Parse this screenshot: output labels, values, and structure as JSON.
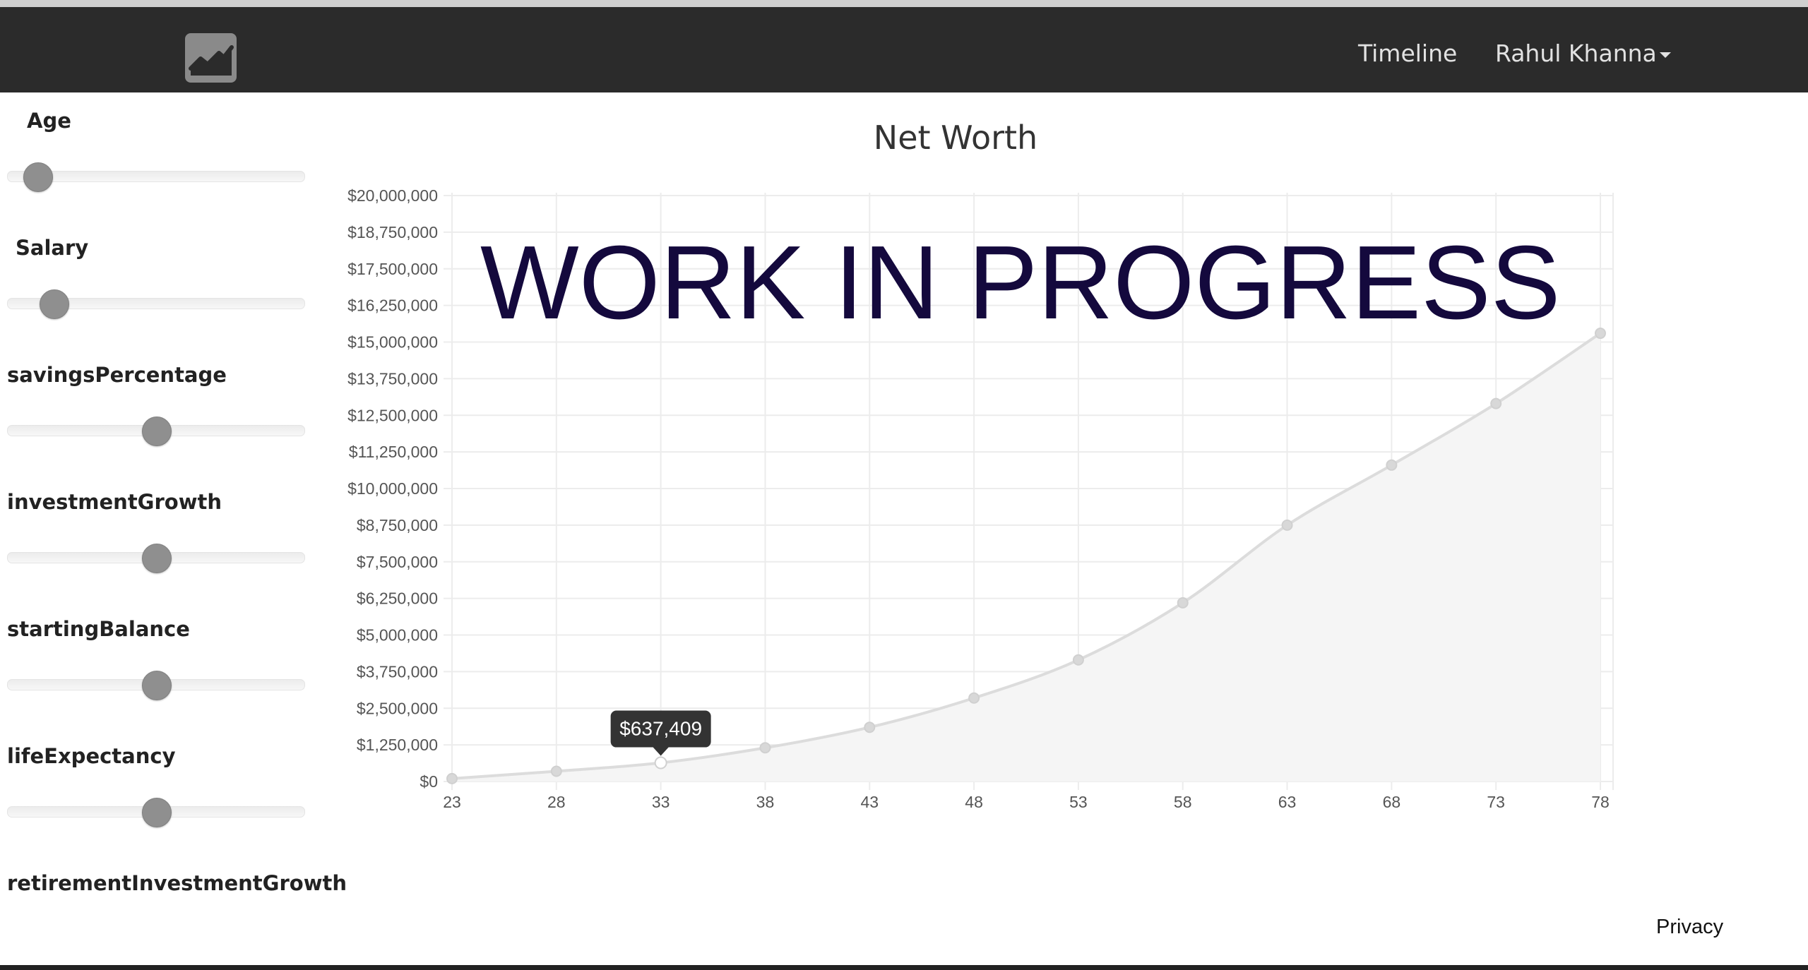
{
  "navbar": {
    "logo_icon": "line-chart-icon",
    "timeline_label": "Timeline",
    "user_label": "Rahul Khanna"
  },
  "sliders": [
    {
      "key": "age",
      "label": "Age",
      "value_fraction": 0.1
    },
    {
      "key": "salary",
      "label": "Salary",
      "value_fraction": 0.155
    },
    {
      "key": "savings",
      "label": "savingsPercentage",
      "value_fraction": 0.5
    },
    {
      "key": "growth",
      "label": "investmentGrowth",
      "value_fraction": 0.5
    },
    {
      "key": "balance",
      "label": "startingBalance",
      "value_fraction": 0.5
    },
    {
      "key": "life",
      "label": "lifeExpectancy",
      "value_fraction": 0.5
    },
    {
      "key": "retire",
      "label": "retirementInvestmentGrowth",
      "value_fraction": null
    }
  ],
  "chart_data": {
    "type": "area",
    "title": "Net Worth",
    "watermark": "WORK IN PROGRESS",
    "x": [
      23,
      28,
      33,
      38,
      43,
      48,
      53,
      58,
      63,
      68,
      73,
      78
    ],
    "values": [
      100000,
      350000,
      637409,
      1150000,
      1850000,
      2850000,
      4150000,
      6100000,
      8750000,
      10800000,
      12900000,
      15300000
    ],
    "ylim": [
      0,
      20000000
    ],
    "y_ticks": [
      "$0",
      "$1,250,000",
      "$2,500,000",
      "$3,750,000",
      "$5,000,000",
      "$6,250,000",
      "$7,500,000",
      "$8,750,000",
      "$10,000,000",
      "$11,250,000",
      "$12,500,000",
      "$13,750,000",
      "$15,000,000",
      "$16,250,000",
      "$17,500,000",
      "$18,750,000",
      "$20,000,000"
    ],
    "x_ticks": [
      "23",
      "28",
      "33",
      "38",
      "43",
      "48",
      "53",
      "58",
      "63",
      "68",
      "73",
      "78"
    ],
    "grid": true,
    "tooltip": {
      "index": 2,
      "label": "$637,409"
    },
    "colors": {
      "line": "#dcdcdc",
      "fill": "#f5f5f5",
      "grid": "#ececec",
      "watermark": "#14093d",
      "tooltip_bg": "#333333"
    }
  },
  "footer": {
    "privacy_label": "Privacy"
  }
}
